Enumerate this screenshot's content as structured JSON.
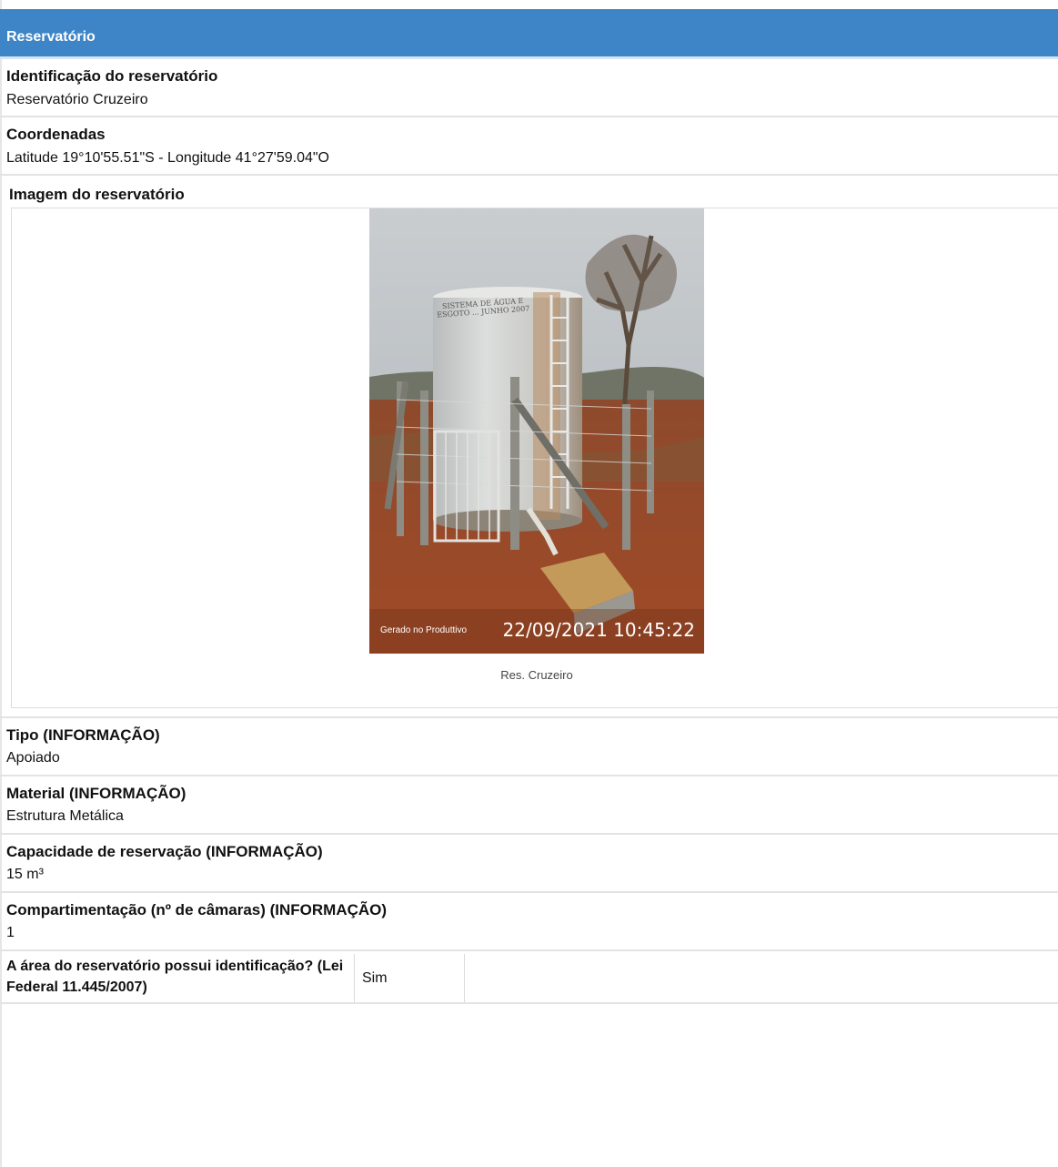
{
  "section": {
    "title": "Reservatório"
  },
  "fields": {
    "identificacao": {
      "label": "Identificação do reservatório",
      "value": "Reservatório Cruzeiro"
    },
    "coordenadas": {
      "label": "Coordenadas",
      "value": "Latitude 19°10'55.51\"S - Longitude 41°27'59.04\"O"
    },
    "imagem": {
      "label": "Imagem do reservatório",
      "caption": "Res. Cruzeiro",
      "stamp_app": "Gerado no Produttivo",
      "stamp_datetime": "22/09/2021 10:45:22",
      "wall_text": "SISTEMA DE ÁGUA E ESGOTO ... JUNHO 2007"
    },
    "tipo": {
      "label": "Tipo (INFORMAÇÃO)",
      "value": "Apoiado"
    },
    "material": {
      "label": "Material (INFORMAÇÃO)",
      "value": "Estrutura Metálica"
    },
    "capacidade": {
      "label": "Capacidade de reservação (INFORMAÇÃO)",
      "value": "15 m³"
    },
    "compartimentacao": {
      "label": "Compartimentação (nº de câmaras) (INFORMAÇÃO)",
      "value": "1"
    }
  },
  "identificacao_area": {
    "label": "A área do reservatório possui identificação? (Lei Federal 11.445/2007)",
    "value": "Sim"
  }
}
